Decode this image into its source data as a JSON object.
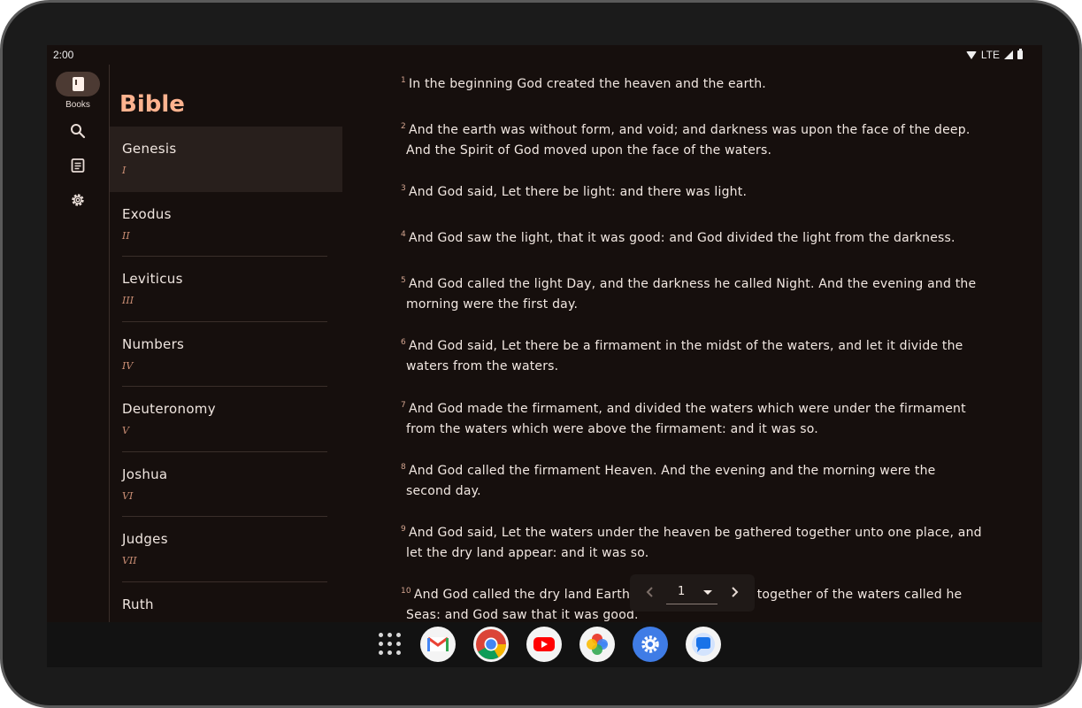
{
  "status_bar": {
    "time": "2:00",
    "network": "LTE"
  },
  "nav_rail": {
    "items": [
      {
        "label": "Books",
        "icon": "book-icon",
        "selected": true
      },
      {
        "label": "",
        "icon": "search-icon"
      },
      {
        "label": "",
        "icon": "document-icon"
      },
      {
        "label": "",
        "icon": "gear-icon"
      }
    ]
  },
  "books_panel": {
    "title": "Bible",
    "books": [
      {
        "name": "Genesis",
        "number": "I",
        "selected": true
      },
      {
        "name": "Exodus",
        "number": "II"
      },
      {
        "name": "Leviticus",
        "number": "III"
      },
      {
        "name": "Numbers",
        "number": "IV"
      },
      {
        "name": "Deuteronomy",
        "number": "V"
      },
      {
        "name": "Joshua",
        "number": "VI"
      },
      {
        "name": "Judges",
        "number": "VII"
      },
      {
        "name": "Ruth",
        "number": ""
      }
    ]
  },
  "verses": [
    {
      "num": "1",
      "text": "In the beginning God created the heaven and the earth."
    },
    {
      "num": "2",
      "text": "And the earth was without form, and void; and darkness was upon the face of the deep. And the Spirit of God moved upon the face of the waters."
    },
    {
      "num": "3",
      "text": "And God said, Let there be light: and there was light."
    },
    {
      "num": "4",
      "text": "And God saw the light, that it was good: and God divided the light from the darkness."
    },
    {
      "num": "5",
      "text": "And God called the light Day, and the darkness he called Night. And the evening and the morning were the first day."
    },
    {
      "num": "6",
      "text": "And God said, Let there be a firmament in the midst of the waters, and let it divide the waters from the waters."
    },
    {
      "num": "7",
      "text": "And God made the firmament, and divided the waters which were under the firmament from the waters which were above the firmament: and it was so."
    },
    {
      "num": "8",
      "text": "And God called the firmament Heaven. And the evening and the morning were the second day."
    },
    {
      "num": "9",
      "text": "And God said, Let the waters under the heaven be gathered together unto one place, and let the dry land appear: and it was so."
    },
    {
      "num": "10",
      "text": "And God called the dry land Earth; and the gathering together of the waters called he Seas: and God saw that it was good."
    }
  ],
  "pager": {
    "chapter": "1",
    "prev_icon": "chevron-left-icon",
    "next_icon": "chevron-right-icon"
  },
  "dock": {
    "apps": [
      "app-drawer-icon",
      "gmail-icon",
      "chrome-icon",
      "youtube-icon",
      "photos-icon",
      "settings-icon",
      "messages-icon"
    ]
  },
  "colors": {
    "background": "#160f0d",
    "accent": "#ffb38f",
    "selected_row": "#281f1c",
    "rail_pill": "#4c3a33"
  }
}
